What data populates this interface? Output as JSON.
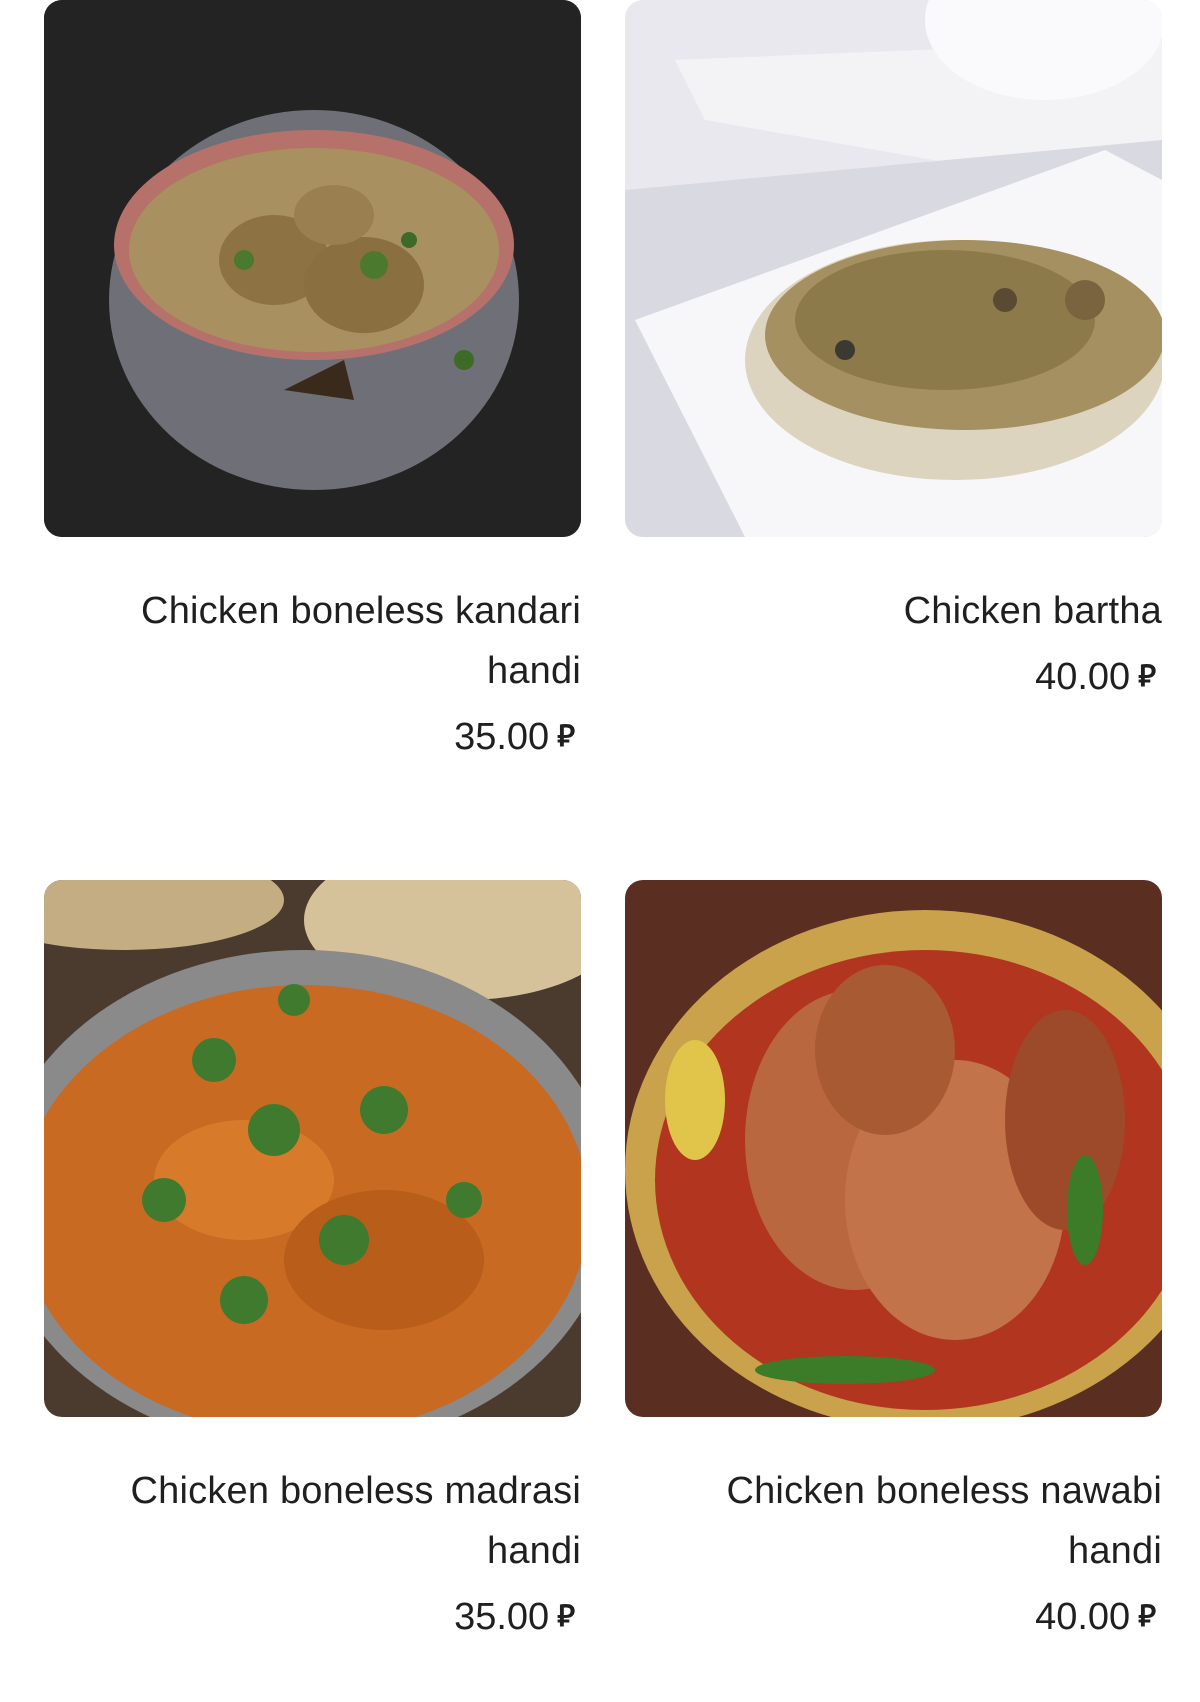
{
  "menu": {
    "items": [
      {
        "name": "Chicken boneless kandari handi",
        "price": "35.00",
        "currency": "⃁",
        "image": "kandari-handi-photo"
      },
      {
        "name": "Chicken bartha",
        "price": "40.00",
        "currency": "⃁",
        "image": "bartha-photo"
      },
      {
        "name": "Chicken boneless madrasi handi",
        "price": "35.00",
        "currency": "⃁",
        "image": "madrasi-handi-photo"
      },
      {
        "name": "Chicken boneless nawabi handi",
        "price": "40.00",
        "currency": "⃁",
        "image": "nawabi-handi-photo"
      }
    ]
  }
}
